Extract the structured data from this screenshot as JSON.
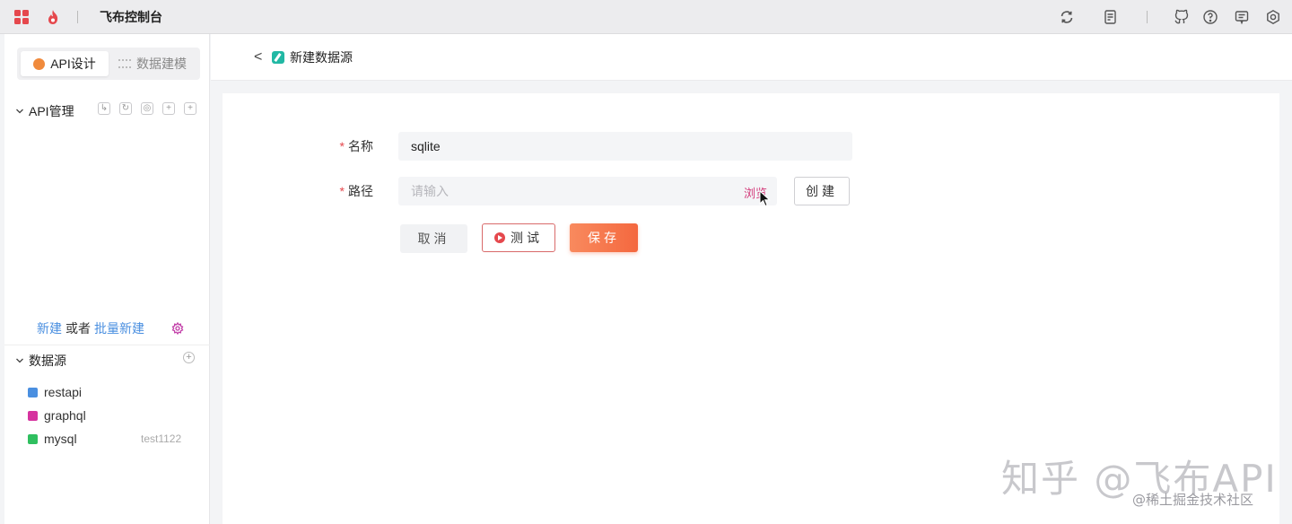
{
  "topbar": {
    "app_title": "飞布控制台",
    "icons": [
      "refresh-icon",
      "document-icon",
      "github-icon",
      "help-icon",
      "message-icon",
      "settings-icon"
    ]
  },
  "sidebar": {
    "tabs": [
      {
        "label": "API设计",
        "active": true
      },
      {
        "label": "数据建模",
        "active": false
      }
    ],
    "api_section": {
      "label": "API管理",
      "tool_glyphs": [
        "↳",
        "↻",
        "◎",
        "+",
        "+"
      ]
    },
    "new_link": "新建",
    "or_text": "或者",
    "batch_link": "批量新建",
    "datasource_section": {
      "label": "数据源",
      "add_glyph": "+"
    },
    "datasources": [
      {
        "name": "restapi",
        "tag": "",
        "color": "#4a8fe0"
      },
      {
        "name": "graphql",
        "tag": "",
        "color": "#d6339f"
      },
      {
        "name": "mysql",
        "tag": "test1122",
        "color": "#2fbf5f"
      }
    ]
  },
  "main": {
    "back_glyph": "<",
    "page_title": "新建数据源",
    "form": {
      "required_mark": "*",
      "name_label": "名称",
      "name_value": "sqlite",
      "path_label": "路径",
      "path_placeholder": "请输入",
      "browse_label": "浏览",
      "create_button": "创建",
      "cancel_button": "取消",
      "test_button": "测试",
      "save_button": "保存"
    }
  },
  "watermark": {
    "main": "知乎 @飞布API",
    "sub": "@稀土掘金技术社区"
  },
  "colors": {
    "accent_orange": "#f4683f",
    "link_blue": "#4a8fe0",
    "required_red": "#e5484d",
    "browse_pink": "#d33a7a",
    "brand_red": "#e5484d"
  }
}
